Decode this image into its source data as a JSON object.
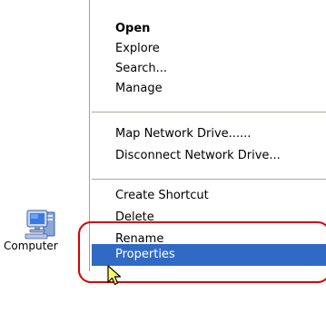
{
  "desktop": {
    "icon": {
      "label": "Computer",
      "icon_name": "computer-icon"
    }
  },
  "context_menu": {
    "groups": [
      {
        "items": [
          {
            "label": "Open",
            "bold": true
          },
          {
            "label": "Explore"
          },
          {
            "label": "Search..."
          },
          {
            "label": "Manage"
          }
        ]
      },
      {
        "items": [
          {
            "label": "Map Network Drive......"
          },
          {
            "label": "Disconnect Network Drive..."
          }
        ]
      },
      {
        "items": [
          {
            "label": "Create Shortcut"
          },
          {
            "label": "Delete"
          },
          {
            "label": "Rename"
          }
        ]
      },
      {
        "items": [
          {
            "label": "Properties",
            "selected": true
          }
        ]
      }
    ]
  },
  "annotation": {
    "highlight_color": "#d40000"
  },
  "colors": {
    "selection": "#316ac5",
    "separator": "#aca899"
  }
}
